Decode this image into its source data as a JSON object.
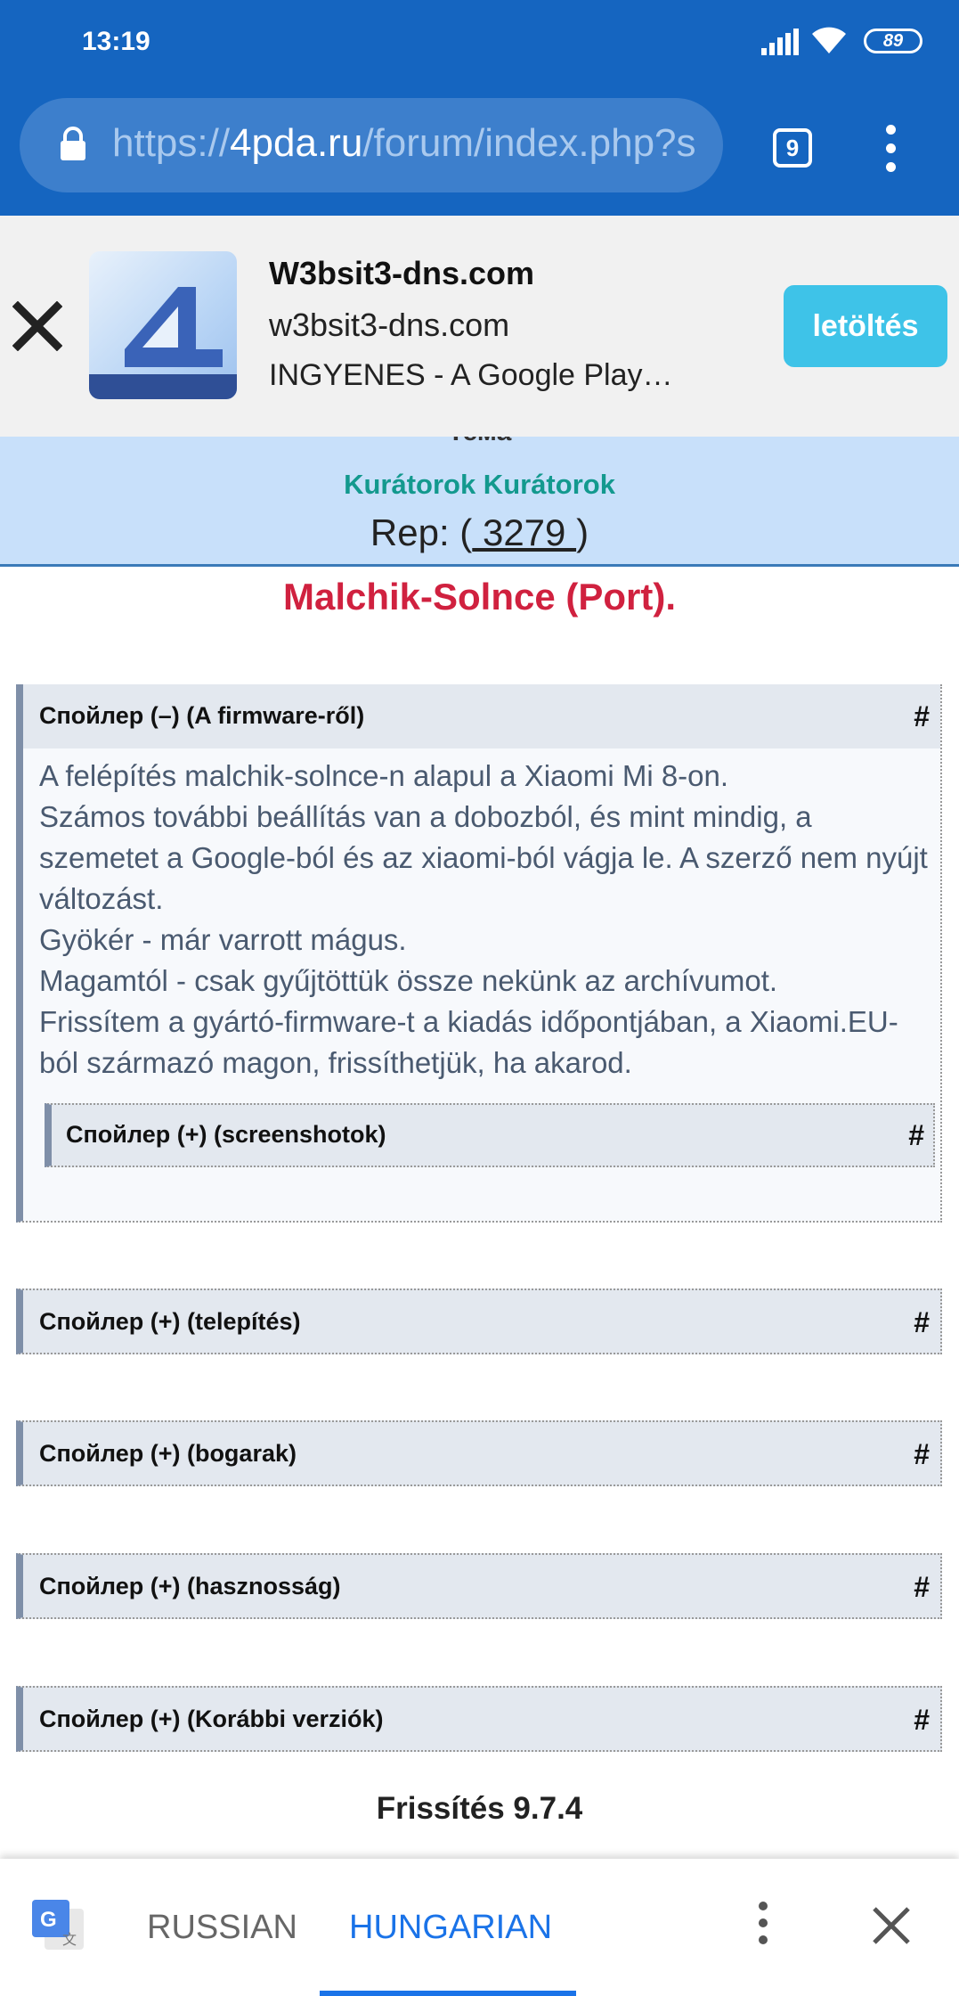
{
  "status_bar": {
    "time": "13:19",
    "battery": "89"
  },
  "browser": {
    "url_scheme": "https://",
    "url_host": "4pda.ru",
    "url_path": "/forum/index.php?s",
    "tab_count": "9"
  },
  "ad": {
    "title": "W3bsit3-dns.com",
    "domain": "w3bsit3-dns.com",
    "description": "INGYENES - A Google Play…",
    "button_label": "letöltés"
  },
  "profile": {
    "cut_label": "Тема",
    "group": "Kurátorok Kurátorok",
    "rep_prefix": "Rep: (",
    "rep_value": " 3279 ",
    "rep_suffix": ")"
  },
  "post": {
    "author": "Malchik-Solnce (Port).",
    "spoilers": [
      {
        "label": "Спойлер (–) (A firmware-ről)",
        "hash": "#",
        "body": [
          "A felépítés malchik-solnce-n alapul a Xiaomi Mi 8-on.",
          "Számos további beállítás van a dobozból, és mint mindig, a szemetet a Google-ból és az xiaomi-ból vágja le. A szerző nem nyújt változást.",
          "Gyökér - már varrott mágus.",
          "Magamtól - csak gyűjtöttük össze nekünk az archívumot.",
          "Frissítem a gyártó-firmware-t a kiadás időpontjában, a Xiaomi.EU-ból származó magon, frissíthetjük, ha akarod."
        ],
        "inner": {
          "label": "Спойлер (+) (screenshotok)",
          "hash": "#"
        }
      },
      {
        "label": "Спойлер (+) (telepítés)",
        "hash": "#"
      },
      {
        "label": "Спойлер (+) (bogarak)",
        "hash": "#"
      },
      {
        "label": "Спойлер (+) (hasznosság)",
        "hash": "#"
      },
      {
        "label": "Спойлер (+) (Korábbi verziók)",
        "hash": "#"
      }
    ],
    "update_title": "Frissítés 9.7.4"
  },
  "translate": {
    "source_lang": "RUSSIAN",
    "target_lang": "HUNGARIAN"
  },
  "colors": {
    "browser_blue": "#1565c0",
    "author_red": "#d0213f",
    "group_teal": "#13998e",
    "install_button": "#3ec3e8",
    "translate_blue": "#1a73e8"
  }
}
